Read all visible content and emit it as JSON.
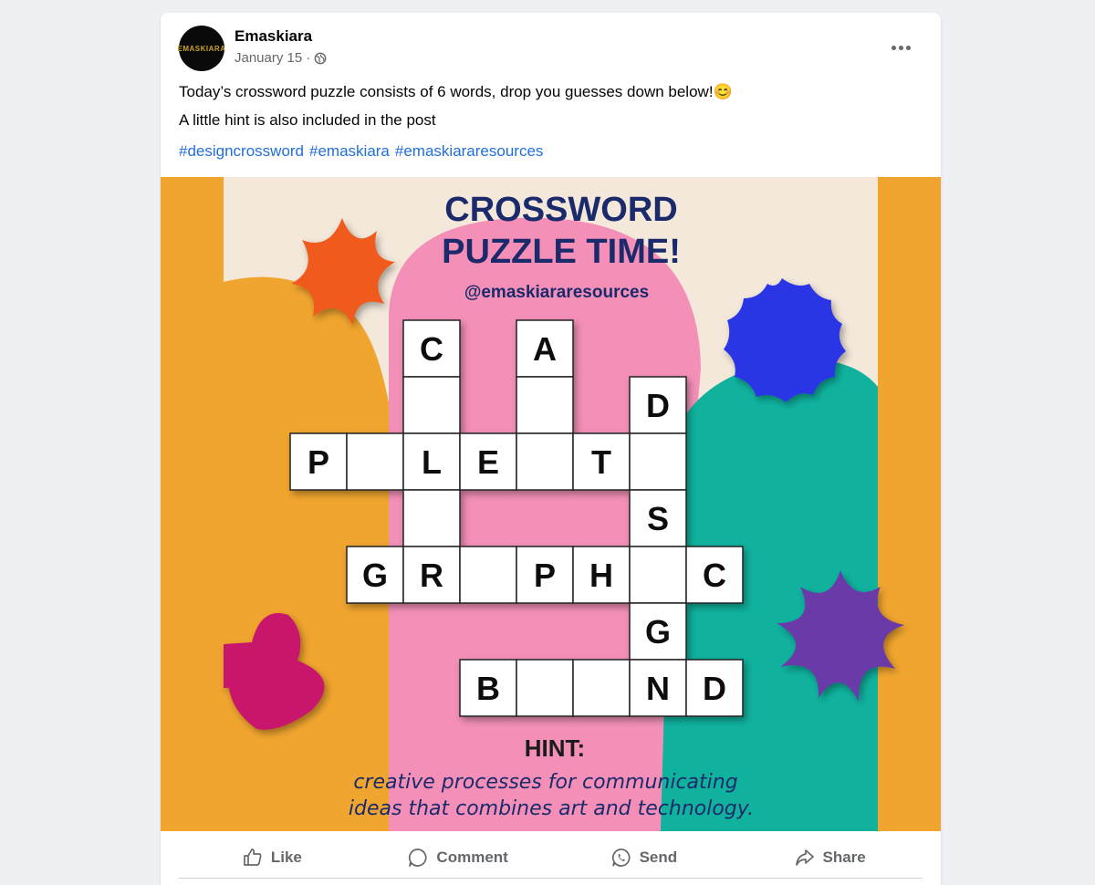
{
  "post": {
    "author": "Emaskiara",
    "avatar_text": "EMASKIARA",
    "date": "January 15",
    "date_separator": "·",
    "line1": "Today’s crossword puzzle consists of 6 words, drop you guesses down below!😊",
    "line2": "A little hint is also included in the post",
    "hashtags": [
      "#designcrossword",
      "#emaskiara",
      "#emaskiararesources"
    ]
  },
  "image": {
    "title_line1": "CROSSWORD",
    "title_line2": "PUZZLE TIME!",
    "handle": "@emaskiararesources",
    "hint_label": "HINT:",
    "hint_line1": "creative processes for communicating",
    "hint_line2": "ideas that combines art and technology.",
    "grid_letters": [
      "C",
      "A",
      "D",
      "P",
      "L",
      "E",
      "T",
      "S",
      "G",
      "R",
      "P",
      "H",
      "C",
      "G",
      "B",
      "N",
      "D"
    ]
  },
  "actions": {
    "like": "Like",
    "comment": "Comment",
    "send": "Send",
    "share": "Share"
  },
  "colors": {
    "orange": "#f0a52e",
    "pink": "#f490b8",
    "teal": "#10b29e",
    "navy": "#1b2a6b",
    "blue": "#2a35e6",
    "red_flower": "#f05a1c",
    "purple_flower": "#6a3aa8",
    "magenta": "#c8146c",
    "link": "#216fdb"
  }
}
